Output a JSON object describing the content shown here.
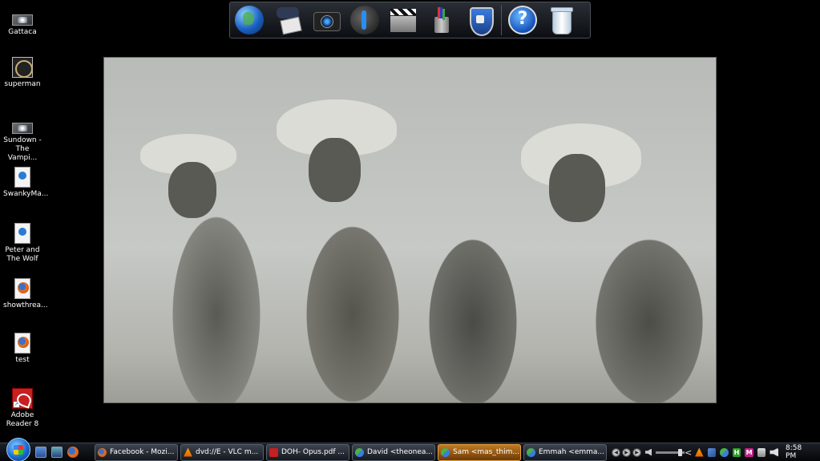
{
  "desktop": {
    "icons": [
      {
        "label": "Gattaca",
        "type": "video"
      },
      {
        "label": "superman",
        "type": "film"
      },
      {
        "label": "Sundown -\nThe Vampi...",
        "type": "video"
      },
      {
        "label": "SwankyMa...",
        "type": "audio-doc"
      },
      {
        "label": "Peter and\nThe Wolf",
        "type": "audio-doc"
      },
      {
        "label": "showthrea...",
        "type": "firefox-doc"
      },
      {
        "label": "test",
        "type": "firefox-doc"
      },
      {
        "label": "Adobe\nReader 8",
        "type": "pdf-shortcut"
      }
    ]
  },
  "dock": {
    "items": [
      "globe-icon",
      "game-controller-icon",
      "camera-icon",
      "music-player-icon",
      "clapperboard-icon",
      "pen-holder-icon",
      "security-shield-icon",
      "help-icon",
      "recycle-bin-icon"
    ],
    "help_glyph": "?"
  },
  "taskbar": {
    "tasks": [
      {
        "label": "Facebook - Mozi...",
        "icon": "firefox-icon",
        "active": false
      },
      {
        "label": "dvd://E - VLC m...",
        "icon": "vlc-icon",
        "active": false
      },
      {
        "label": "DOH- Opus.pdf ...",
        "icon": "pdf-icon",
        "active": false
      },
      {
        "label": "David <theonea...",
        "icon": "messenger-icon",
        "active": false
      },
      {
        "label": "Sam <mas_thim...",
        "icon": "messenger-icon",
        "active": true
      },
      {
        "label": "Emmah <emma...",
        "icon": "messenger-icon",
        "active": false
      }
    ],
    "tray": {
      "chevron": "<",
      "h_badge": "H",
      "m_badge": "M",
      "clock": "8:58 PM"
    }
  }
}
